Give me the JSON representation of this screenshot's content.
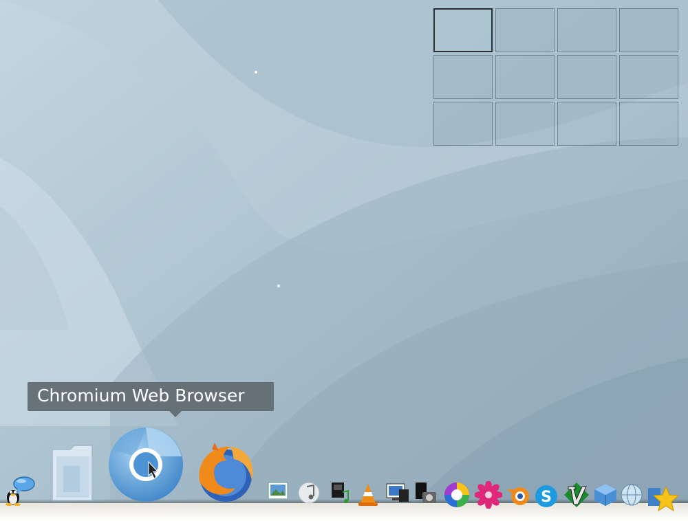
{
  "tooltip": {
    "text": "Chromium Web Browser"
  },
  "pager": {
    "workspace_count": 12,
    "active_index": 0
  },
  "dock": {
    "items": [
      {
        "name": "tux-icon"
      },
      {
        "name": "chat-bubble-icon"
      },
      {
        "name": "home-folder-icon"
      },
      {
        "name": "chromium-icon"
      },
      {
        "name": "firefox-icon"
      },
      {
        "name": "image-viewer-icon"
      },
      {
        "name": "music-note-icon"
      },
      {
        "name": "music-player-icon"
      },
      {
        "name": "vlc-cone-icon"
      },
      {
        "name": "desktop-screenshot-icon"
      },
      {
        "name": "camera-terminal-icon"
      },
      {
        "name": "color-wheel-icon"
      },
      {
        "name": "pink-flower-icon"
      },
      {
        "name": "blender-icon"
      },
      {
        "name": "skype-icon"
      },
      {
        "name": "vim-icon"
      },
      {
        "name": "virtualbox-cube-icon"
      },
      {
        "name": "network-globe-icon"
      },
      {
        "name": "star-bookmark-icon"
      }
    ]
  },
  "colors": {
    "wallpaper_light": "#c3d6e0",
    "wallpaper_dark": "#7f98a8",
    "tooltip_bg": "#5f6970",
    "tooltip_text": "#ffffff"
  }
}
